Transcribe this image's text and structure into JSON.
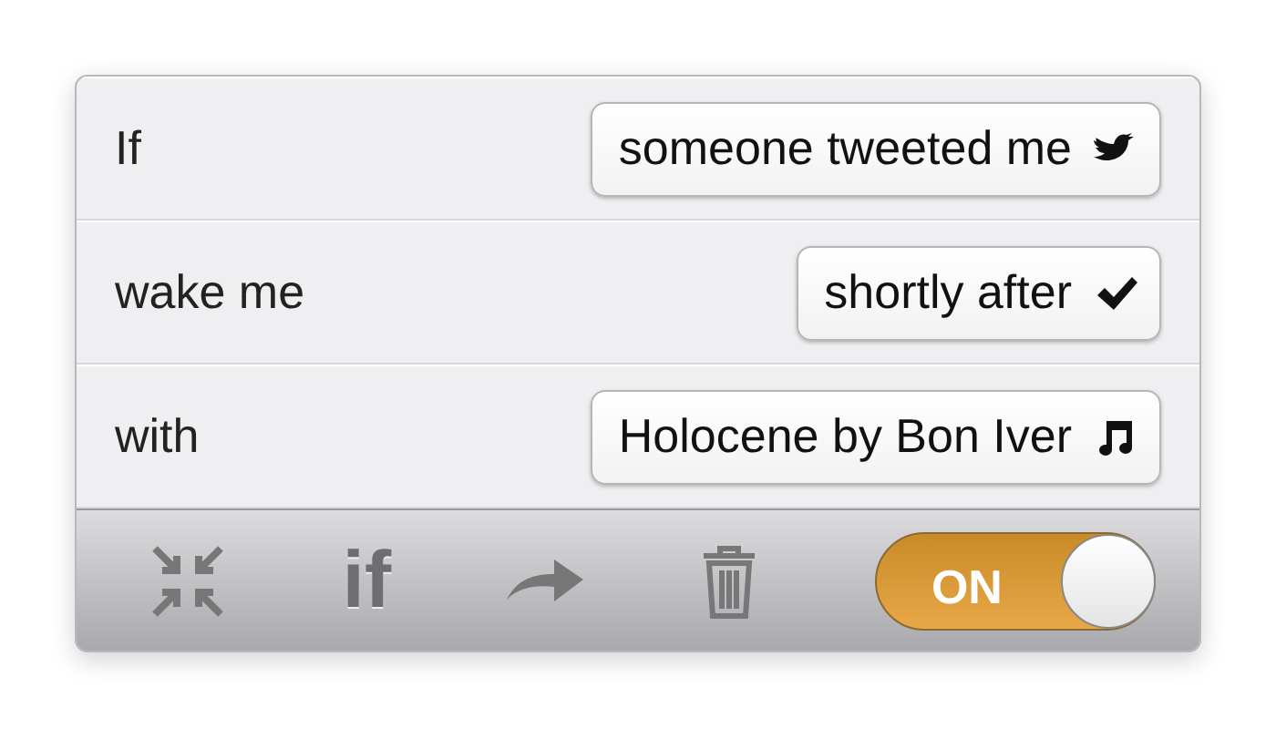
{
  "rules": [
    {
      "label": "If",
      "value": "someone tweeted me",
      "kind": "bird"
    },
    {
      "label": "wake me",
      "value": "shortly after",
      "kind": "check"
    },
    {
      "label": "with",
      "value": "Holocene by Bon Iver",
      "kind": "music"
    }
  ],
  "toolbar": {
    "if_label": "if",
    "toggle": {
      "label": "ON",
      "on": true
    }
  }
}
